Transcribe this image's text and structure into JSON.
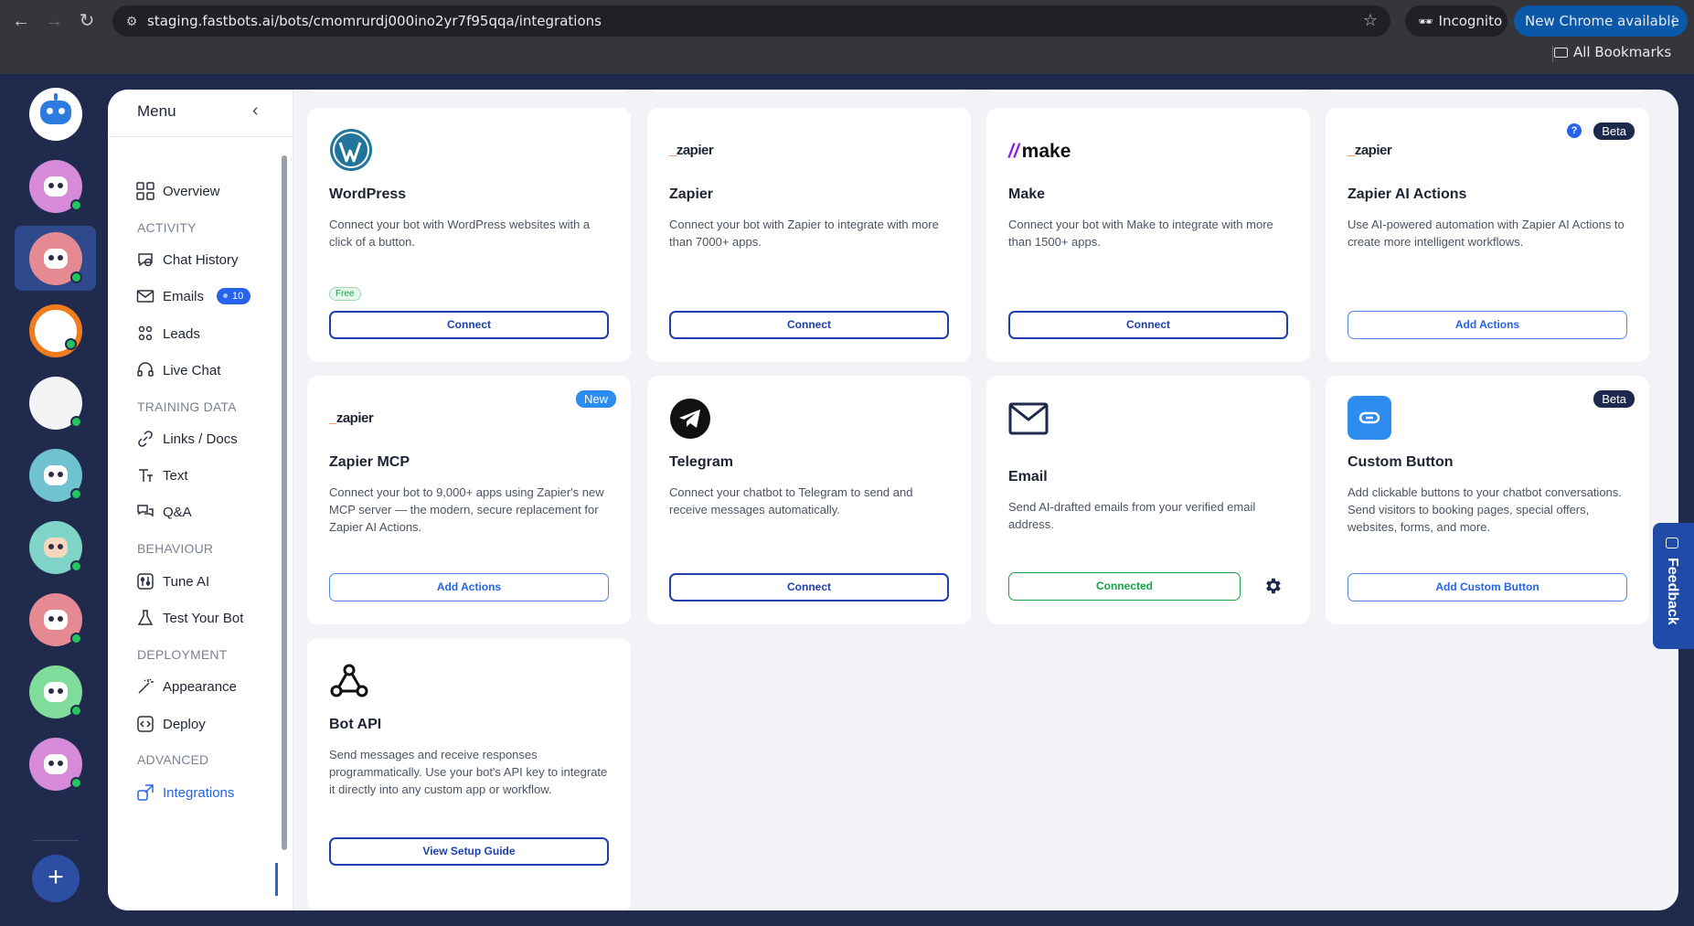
{
  "browser": {
    "url": "staging.fastbots.ai/bots/cmomrurdj000ino2yr7f95qqa/integrations",
    "incognito_label": "Incognito",
    "update_label": "New Chrome available",
    "bookmarks_label": "All Bookmarks"
  },
  "menu": {
    "title": "Menu",
    "items": {
      "overview": "Overview",
      "chat_history": "Chat History",
      "emails": "Emails",
      "emails_badge": "10",
      "leads": "Leads",
      "live_chat": "Live Chat",
      "links_docs": "Links / Docs",
      "text": "Text",
      "qa": "Q&A",
      "tune_ai": "Tune AI",
      "test_bot": "Test Your Bot",
      "appearance": "Appearance",
      "deploy": "Deploy",
      "integrations": "Integrations"
    },
    "sections": {
      "activity": "ACTIVITY",
      "training": "TRAINING DATA",
      "behaviour": "BEHAVIOUR",
      "deployment": "DEPLOYMENT",
      "advanced": "ADVANCED"
    }
  },
  "integrations": {
    "wordpress": {
      "title": "WordPress",
      "desc": "Connect your bot with WordPress websites with a click of a button.",
      "pill": "Free",
      "button": "Connect"
    },
    "zapier": {
      "logo": "zapier",
      "title": "Zapier",
      "desc": "Connect your bot with Zapier to integrate with more than 7000+ apps.",
      "button": "Connect"
    },
    "make": {
      "logo": "make",
      "title": "Make",
      "desc": "Connect your bot with Make to integrate with more than 1500+ apps.",
      "button": "Connect"
    },
    "zapier_ai": {
      "logo": "zapier",
      "title": "Zapier AI Actions",
      "desc": "Use AI-powered automation with Zapier AI Actions to create more intelligent workflows.",
      "tag": "Beta",
      "button": "Add Actions"
    },
    "zapier_mcp": {
      "logo": "zapier",
      "title": "Zapier MCP",
      "desc": "Connect your bot to 9,000+ apps using Zapier's new MCP server — the modern, secure replacement for Zapier AI Actions.",
      "tag": "New",
      "button": "Add Actions"
    },
    "telegram": {
      "title": "Telegram",
      "desc": "Connect your chatbot to Telegram to send and receive messages automatically.",
      "button": "Connect"
    },
    "email": {
      "title": "Email",
      "desc": "Send AI-drafted emails from your verified email address.",
      "button": "Connected"
    },
    "custom_button": {
      "title": "Custom Button",
      "desc": "Add clickable buttons to your chatbot conversations. Send visitors to booking pages, special offers, websites, forms, and more.",
      "tag": "Beta",
      "button": "Add Custom Button"
    },
    "bot_api": {
      "title": "Bot API",
      "desc": "Send messages and receive responses programmatically. Use your bot's API key to integrate it directly into any custom app or workflow.",
      "button": "View Setup Guide"
    }
  },
  "feedback_label": "Feedback",
  "colors": {
    "accent": "#2563eb",
    "navy": "#1f2a4d",
    "success": "#16a34a"
  }
}
